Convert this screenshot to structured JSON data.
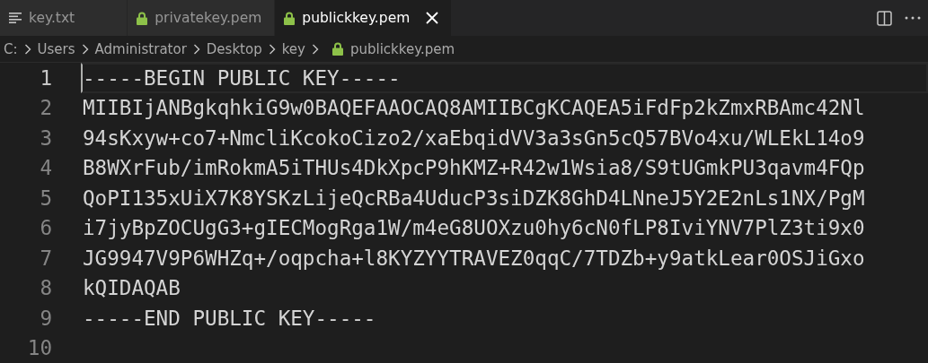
{
  "tabs": [
    {
      "label": "key.txt",
      "kind": "text",
      "selected": false,
      "closable": false
    },
    {
      "label": "privatekey.pem",
      "kind": "lock",
      "selected": false,
      "closable": false
    },
    {
      "label": "publickkey.pem",
      "kind": "lock",
      "selected": true,
      "closable": true
    }
  ],
  "breadcrumb": [
    {
      "label": "C:",
      "kind": "folder"
    },
    {
      "label": "Users",
      "kind": "folder"
    },
    {
      "label": "Administrator",
      "kind": "folder"
    },
    {
      "label": "Desktop",
      "kind": "folder"
    },
    {
      "label": "key",
      "kind": "folder"
    },
    {
      "label": "publickkey.pem",
      "kind": "lock"
    }
  ],
  "lines": [
    {
      "number": "1",
      "text": "-----BEGIN PUBLIC KEY-----",
      "current": true
    },
    {
      "number": "2",
      "text": "MIIBIjANBgkqhkiG9w0BAQEFAAOCAQ8AMIIBCgKCAQEA5iFdFp2kZmxRBAmc42Nl",
      "current": false
    },
    {
      "number": "3",
      "text": "94sKxyw+co7+NmcliKcokoCizo2/xaEbqidVV3a3sGn5cQ57BVo4xu/WLEkL14o9",
      "current": false
    },
    {
      "number": "4",
      "text": "B8WXrFub/imRokmA5iTHUs4DkXpcP9hKMZ+R42w1Wsia8/S9tUGmkPU3qavm4FQp",
      "current": false
    },
    {
      "number": "5",
      "text": "QoPI135xUiX7K8YSKzLijeQcRBa4UducP3siDZK8GhD4LNneJ5Y2E2nLs1NX/PgM",
      "current": false
    },
    {
      "number": "6",
      "text": "i7jyBpZOCUgG3+gIECMogRga1W/m4eG8UOXzu0hy6cN0fLP8IviYNV7PlZ3ti9x0",
      "current": false
    },
    {
      "number": "7",
      "text": "JG9947V9P6WHZq+/oqpcha+l8KYZYYTRAVEZ0qqC/7TDZb+y9atkLear0OSJiGxo",
      "current": false
    },
    {
      "number": "8",
      "text": "kQIDAQAB",
      "current": false
    },
    {
      "number": "9",
      "text": "-----END PUBLIC KEY-----",
      "current": false
    },
    {
      "number": "10",
      "current": false
    }
  ]
}
